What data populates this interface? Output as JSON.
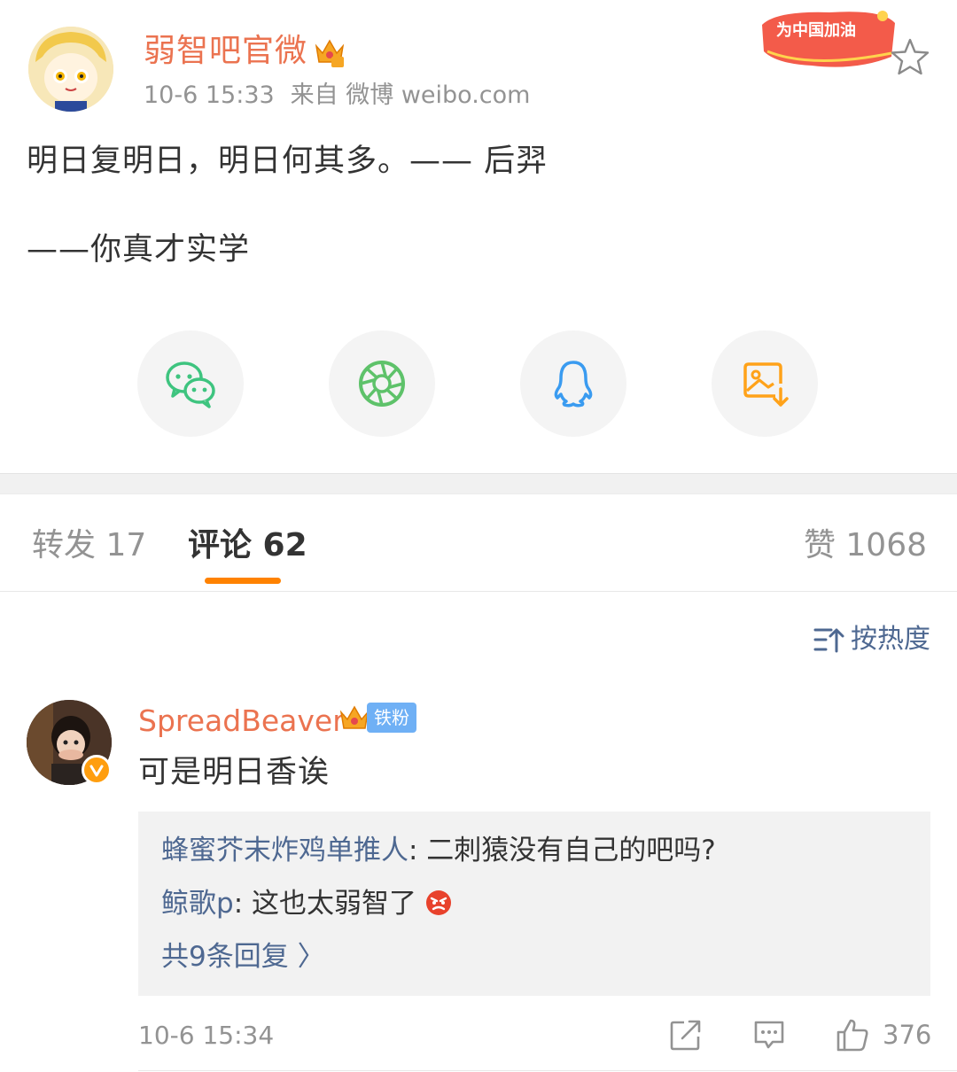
{
  "post": {
    "author": "弱智吧官微",
    "time": "10-6 15:33",
    "source": "来自 微博 weibo.com",
    "event_badge": "为中国加油",
    "line1": "明日复明日，明日何其多。—— 后羿",
    "line2": "——你真才实学"
  },
  "share": {
    "items": [
      "wechat-icon",
      "moments-icon",
      "qq-icon",
      "save-image-icon"
    ]
  },
  "tabs": {
    "repost": "转发 17",
    "comment": "评论 62",
    "like": "赞 1068"
  },
  "sort": {
    "label": "按热度"
  },
  "comment": {
    "user": "SpreadBeaver",
    "fan_badge": "铁粉",
    "text": "可是明日香诶",
    "replies": [
      {
        "name": "蜂蜜芥末炸鸡单推人",
        "text": ": 二刺猿没有自己的吧吗?"
      },
      {
        "name": "鲸歌p",
        "text": ": 这也太弱智了"
      }
    ],
    "more_replies": "共9条回复 〉",
    "time": "10-6 15:34",
    "likes": "376"
  },
  "colors": {
    "accent": "#eb7350",
    "link": "#4e6891",
    "tab_indicator": "#ff8200",
    "wechat": "#3ec47f",
    "moments": "#5ec26a",
    "qq": "#3a9bf0",
    "save": "#ffa219"
  }
}
